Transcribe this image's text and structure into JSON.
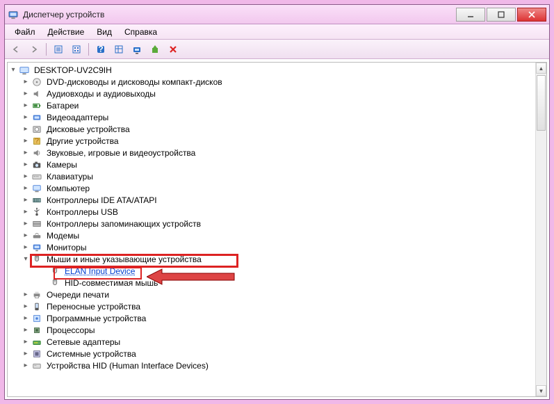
{
  "window": {
    "title": "Диспетчер устройств"
  },
  "menu": {
    "file": "Файл",
    "action": "Действие",
    "view": "Вид",
    "help": "Справка"
  },
  "root": {
    "label": "DESKTOP-UV2C9IH"
  },
  "categories": [
    {
      "id": "dvd",
      "label": "DVD-дисководы и дисководы компакт-дисков"
    },
    {
      "id": "audio",
      "label": "Аудиовходы и аудиовыходы"
    },
    {
      "id": "battery",
      "label": "Батареи"
    },
    {
      "id": "video",
      "label": "Видеоадаптеры"
    },
    {
      "id": "disk",
      "label": "Дисковые устройства"
    },
    {
      "id": "other",
      "label": "Другие устройства"
    },
    {
      "id": "sound",
      "label": "Звуковые, игровые и видеоустройства"
    },
    {
      "id": "camera",
      "label": "Камеры"
    },
    {
      "id": "keyboard",
      "label": "Клавиатуры"
    },
    {
      "id": "computer",
      "label": "Компьютер"
    },
    {
      "id": "ide",
      "label": "Контроллеры IDE ATA/ATAPI"
    },
    {
      "id": "usb",
      "label": "Контроллеры USB"
    },
    {
      "id": "storage",
      "label": "Контроллеры запоминающих устройств"
    },
    {
      "id": "modem",
      "label": "Модемы"
    },
    {
      "id": "monitor",
      "label": "Мониторы"
    },
    {
      "id": "mouse",
      "label": "Мыши и иные указывающие устройства",
      "expanded": true,
      "children": [
        {
          "id": "elan",
          "label": "ELAN Input Device",
          "selected": true
        },
        {
          "id": "hid",
          "label": "HID-совместимая мышь"
        }
      ]
    },
    {
      "id": "print",
      "label": "Очереди печати"
    },
    {
      "id": "portable",
      "label": "Переносные устройства"
    },
    {
      "id": "software",
      "label": "Программные устройства"
    },
    {
      "id": "cpu",
      "label": "Процессоры"
    },
    {
      "id": "network",
      "label": "Сетевые адаптеры"
    },
    {
      "id": "system",
      "label": "Системные устройства"
    },
    {
      "id": "hiddev",
      "label": "Устройства HID (Human Interface Devices)"
    }
  ]
}
